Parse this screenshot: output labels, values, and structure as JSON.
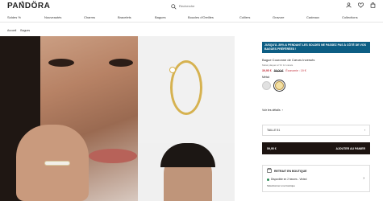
{
  "header": {
    "logo": "PANDÖRA",
    "search_placeholder": "Recherche",
    "icons": [
      "user-icon",
      "heart-icon",
      "bag-icon"
    ]
  },
  "nav": {
    "items": [
      "Soldes %",
      "Nouveautés",
      "Charms",
      "Bracelets",
      "Bagues",
      "Boucles d'Oreilles",
      "Colliers",
      "Gravure",
      "Cadeaux",
      "Collections"
    ]
  },
  "breadcrumb": {
    "items": [
      "Accueil",
      "Bagues"
    ]
  },
  "product": {
    "promo": "JUSQU'À -50% & PENDANT LES SOLDES NE PASSEZ PAS À CÔTÉ DE VOS BAGUES PRÉFÉRÉES !",
    "title": "Bague Couronne de Cœurs Inversés",
    "subtitle": "Métal plaqué à l'Or 14 carats",
    "price_new": "39,95 €",
    "price_old": "59,00 €",
    "price_save": "Économie : 19 €",
    "metal_label": "Métal:",
    "details_label": "Voir les détails",
    "size_label": "TAILLE 51",
    "cta_left": "59,95 €",
    "cta_right": "AJOUTER AU PANIER",
    "pickup_title": "RETRAIT EN BOUTIQUE",
    "pickup_status": "Disponible en 2 heures - Vinted",
    "pickup_link": "Sélectionner une boutique"
  },
  "colors": {
    "promo": "#0d5e84",
    "price": "#c4343f",
    "cta": "#1d1411"
  }
}
